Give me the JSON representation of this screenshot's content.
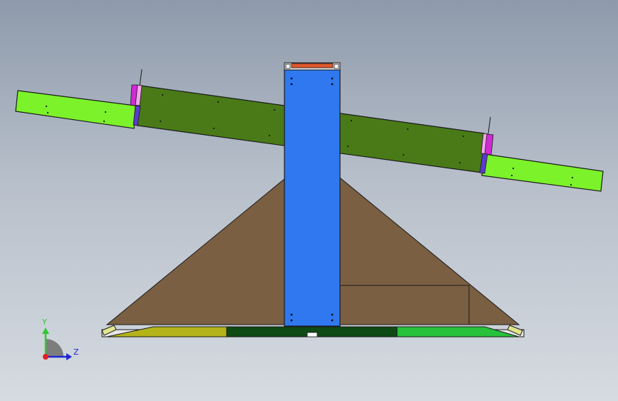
{
  "view": {
    "title": "",
    "background_top": "#8e9aab",
    "background_bottom": "#d6dbe1"
  },
  "model": {
    "colors": {
      "outline": "#1a1a1a",
      "light_green": "#7cf22a",
      "dark_green": "#4a7a18",
      "pink": "#f4a3f0",
      "magenta": "#d02ad4",
      "purple": "#5a3ad0",
      "blue_column": "#2f78f0",
      "orange_cap": "#e0582a",
      "brown_pyramid": "#7a5f42",
      "olive_base": "#b4b41a",
      "forest_base": "#0e4a14",
      "bright_base": "#27c23a",
      "base_strip": "#e6e6e6",
      "yellowish_end": "#e1e68e"
    }
  },
  "triad": {
    "y_label": "Y",
    "z_label": "Z",
    "y_color": "#32c832",
    "z_color": "#1e28d2",
    "x_color": "#e61e1e",
    "hub_color": "#7d7d7d"
  }
}
